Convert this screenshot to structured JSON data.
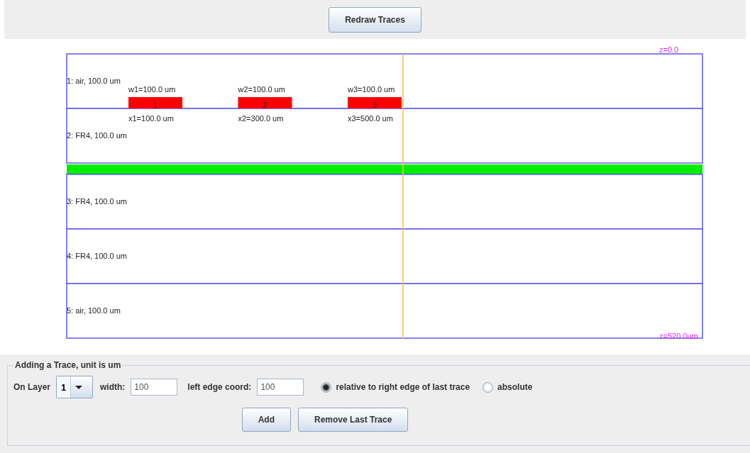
{
  "toolbar": {
    "redraw_button": "Redraw Traces"
  },
  "stackup": {
    "top_label": "z=0.0",
    "bottom_label": "z=520.0um",
    "layers": [
      {
        "kind": "dielectric",
        "label": "1: air, 100.0 um"
      },
      {
        "kind": "dielectric",
        "label": "2: FR4, 100.0 um"
      },
      {
        "kind": "plane"
      },
      {
        "kind": "dielectric",
        "label": "3: FR4, 100.0 um"
      },
      {
        "kind": "dielectric",
        "label": "4: FR4, 100.0 um"
      },
      {
        "kind": "dielectric",
        "label": "5: air, 100.0 um"
      }
    ],
    "traces": [
      {
        "number": "1",
        "width_label": "w1=100.0 um",
        "x_label": "x1=100.0 um"
      },
      {
        "number": "2",
        "width_label": "w2=100.0 um",
        "x_label": "x2=300.0 um"
      },
      {
        "number": "3",
        "width_label": "w3=100.0 um",
        "x_label": "x3=500.0 um"
      }
    ]
  },
  "add_panel": {
    "title": "Adding a Trace, unit is um",
    "layer_label": "On Layer",
    "layer_value": "1",
    "width_label": "width:",
    "width_value": "100",
    "left_edge_label": "left edge coord:",
    "left_edge_value": "100",
    "modes": [
      {
        "label": "relative to right edge of last trace",
        "selected": true
      },
      {
        "label": "absolute",
        "selected": false
      }
    ],
    "buttons": [
      "Add",
      "Remove Last Trace"
    ]
  }
}
